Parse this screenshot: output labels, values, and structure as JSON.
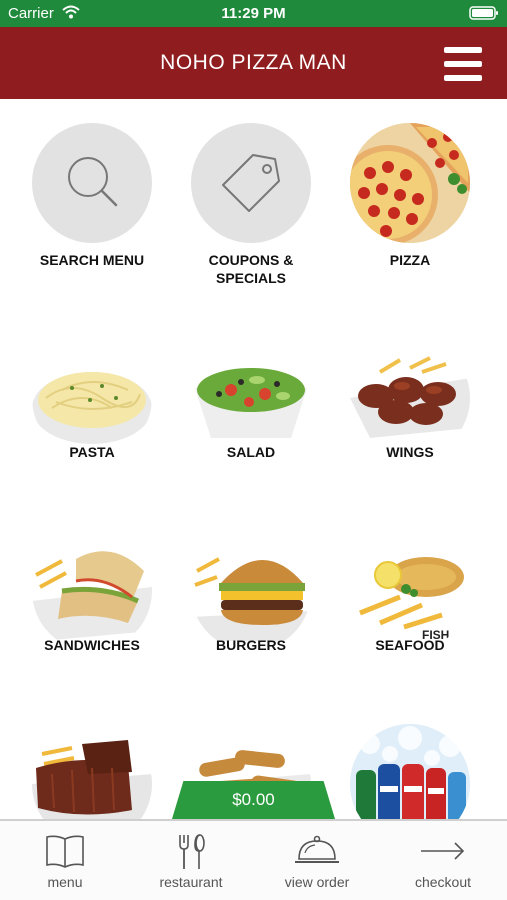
{
  "status_bar": {
    "carrier": "Carrier",
    "time": "11:29 PM"
  },
  "header": {
    "title": "NOHO PIZZA MAN"
  },
  "menu_grid": [
    {
      "label": "SEARCH MENU"
    },
    {
      "label": "COUPONS & SPECIALS"
    },
    {
      "label": "PIZZA"
    },
    {
      "label": "PASTA"
    },
    {
      "label": "SALAD"
    },
    {
      "label": "WINGS"
    },
    {
      "label": "SANDWICHES"
    },
    {
      "label": "BURGERS"
    },
    {
      "label": "SEAFOOD"
    }
  ],
  "cart": {
    "total": "$0.00"
  },
  "tab_bar": {
    "menu": "menu",
    "restaurant": "restaurant",
    "view_order": "view order",
    "checkout": "checkout"
  },
  "colors": {
    "header": "#8f1c1e",
    "status_bar": "#1f8a3c",
    "price_tab": "#2b9b3f"
  }
}
